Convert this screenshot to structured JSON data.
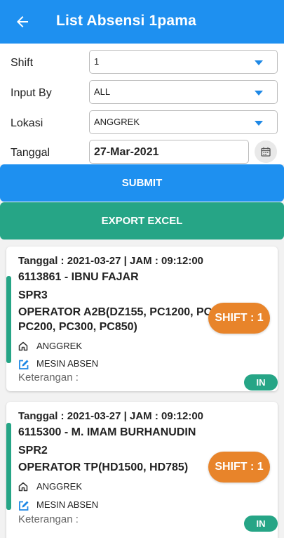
{
  "header": {
    "title": "List Absensi 1pama"
  },
  "form": {
    "shift": {
      "label": "Shift",
      "value": "1"
    },
    "input_by": {
      "label": "Input By",
      "value": "ALL"
    },
    "lokasi": {
      "label": "Lokasi",
      "value": "ANGGREK"
    },
    "tanggal": {
      "label": "Tanggal",
      "value": "27-Mar-2021"
    }
  },
  "actions": {
    "submit": "SUBMIT",
    "export": "EXPORT EXCEL"
  },
  "colors": {
    "primary": "#1e90f0",
    "green": "#26a586",
    "orange": "#e8842a"
  },
  "records": [
    {
      "datetime": "Tanggal : 2021-03-27 | JAM : 09:12:00",
      "employee": "6113861 - IBNU FAJAR",
      "code": "SPR3",
      "position_line1": "OPERATOR A2B(DZ155, PC1200, PC",
      "position_line2": "PC200, PC300, PC850)",
      "location": "ANGGREK",
      "source": "MESIN ABSEN",
      "keterangan": "Keterangan :",
      "shift": "SHIFT : 1",
      "status": "IN"
    },
    {
      "datetime": "Tanggal : 2021-03-27 | JAM : 09:12:00",
      "employee": "6115300 - M. IMAM BURHANUDIN",
      "code": "SPR2",
      "position_line1": "OPERATOR TP(HD1500, HD785)",
      "location": "ANGGREK",
      "source": "MESIN ABSEN",
      "keterangan": "Keterangan :",
      "shift": "SHIFT : 1",
      "status": "IN"
    }
  ]
}
